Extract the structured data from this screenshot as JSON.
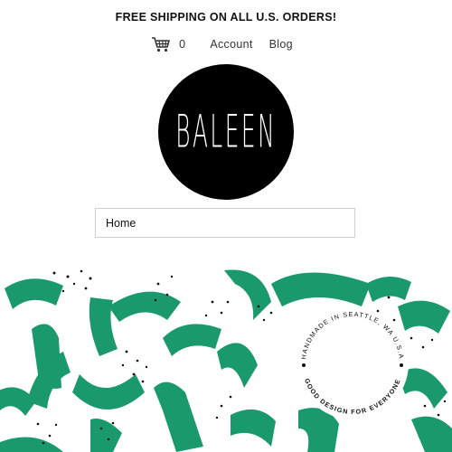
{
  "announcement": "FREE SHIPPING ON ALL U.S. ORDERS!",
  "header": {
    "cart_icon": "cart-icon",
    "cart_count": "0",
    "account_label": "Account",
    "blog_label": "Blog"
  },
  "logo": {
    "text": "BALEEN",
    "background": "#000000"
  },
  "menu": {
    "selected": "Home"
  },
  "hero": {
    "stamp_top": "HANDMADE IN SEATTLE, WA U.S.A",
    "stamp_bottom": "GOOD DESIGN FOR EVERYONE",
    "accent_color": "#1a9a6c"
  }
}
